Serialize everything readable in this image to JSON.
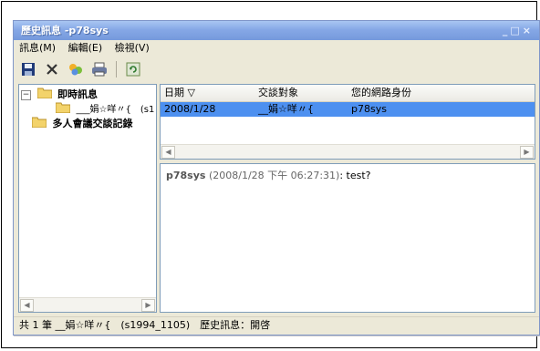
{
  "window": {
    "title": "歷史訊息 -p78sys",
    "controls": "_□×"
  },
  "menu": [
    {
      "label": "訊息(M)"
    },
    {
      "label": "編輯(E)"
    },
    {
      "label": "檢視(V)"
    }
  ],
  "toolbar": {
    "icons": [
      "save-icon",
      "delete-icon",
      "contacts-icon",
      "print-icon",
      "refresh-icon"
    ]
  },
  "tree": {
    "root_label": "即時訊息",
    "child_label": "___娟☆咩〃{　(s1",
    "root2_label": "多人會議交談記錄"
  },
  "list": {
    "headers": [
      "日期 ▽",
      "交談對象",
      "您的網路身份"
    ],
    "rows": [
      {
        "date": "2008/1/28",
        "partner": "__娟☆咩〃{",
        "identity": "p78sys"
      }
    ]
  },
  "message": {
    "sender": "p78sys",
    "timestamp": "(2008/1/28 下午 06:27:31)",
    "text": ": test?"
  },
  "status": {
    "text": "共 1 筆 __娟☆咩〃{　(s1994_1105)　歷史訊息：開啓"
  },
  "colors": {
    "accent": "#7599dc",
    "selection": "#4d90f0",
    "window_bg": "#ece9d8"
  }
}
